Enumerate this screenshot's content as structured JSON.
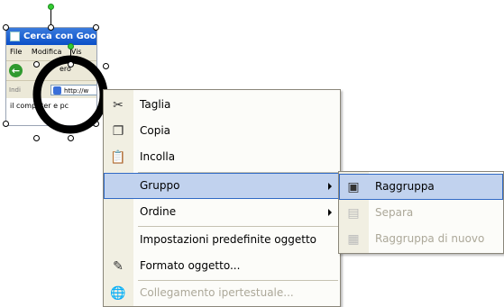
{
  "thumbnail": {
    "title": "Cerca con Goo",
    "menubar": "File Modifica Vis",
    "nav_label": "ero",
    "address_prefix": "Indi",
    "address_text": "http://w",
    "body_text": "il computer e pc"
  },
  "context_menu": {
    "items": [
      {
        "label": "Taglia",
        "icon": "scissors-icon"
      },
      {
        "label": "Copia",
        "icon": "copy-icon"
      },
      {
        "label": "Incolla",
        "icon": "paste-icon"
      },
      {
        "label": "Gruppo",
        "submenu": true,
        "highlighted": true
      },
      {
        "label": "Ordine",
        "submenu": true
      },
      {
        "label": "Impostazioni predefinite oggetto"
      },
      {
        "label": "Formato oggetto...",
        "icon": "format-object-icon"
      },
      {
        "label": "Collegamento ipertestuale...",
        "icon": "hyperlink-icon",
        "disabled": true
      }
    ]
  },
  "group_submenu": {
    "items": [
      {
        "label": "Raggruppa",
        "icon": "group-icon",
        "highlighted": true
      },
      {
        "label": "Separa",
        "icon": "ungroup-icon",
        "disabled": true
      },
      {
        "label": "Raggruppa di nuovo",
        "icon": "regroup-icon",
        "disabled": true
      }
    ]
  },
  "colors": {
    "highlight": "#c1d2ee",
    "highlight_border": "#316ac5",
    "disabled_text": "#aca899",
    "rotation_handle": "#33cc33"
  }
}
